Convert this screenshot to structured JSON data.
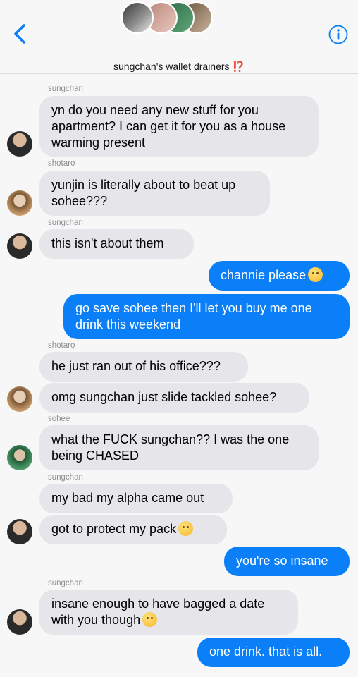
{
  "header": {
    "title": "sungchan's wallet drainers",
    "title_mark": "⁉️",
    "back_icon": "chevron-left-icon",
    "info_icon": "info-icon",
    "accent": "#0b7ff7"
  },
  "messages": [
    {
      "sender": "sungchan",
      "lines": [
        "yn do you need any new stuff for you",
        "apartment? I can get it for you as a house",
        "warming present"
      ]
    },
    {
      "sender": "shotaro",
      "lines": [
        "yunjin is literally about to beat up",
        "sohee???"
      ]
    },
    {
      "sender": "sungchan",
      "lines": [
        "this isn't about them"
      ]
    },
    {
      "sender": "me",
      "lines": [
        "channie please"
      ],
      "emoji": "crying-emoji"
    },
    {
      "sender": "me",
      "lines": [
        "go save sohee then I'll let you buy me one",
        "drink this weekend"
      ]
    },
    {
      "sender": "shotaro",
      "lines": [
        "he just ran out of his office???"
      ]
    },
    {
      "sender": "shotaro",
      "lines": [
        "omg sungchan just slide tackled sohee?"
      ]
    },
    {
      "sender": "sohee",
      "lines": [
        "what the FUCK sungchan?? I was the one",
        "being CHASED"
      ]
    },
    {
      "sender": "sungchan",
      "lines": [
        "my bad my alpha came out"
      ]
    },
    {
      "sender": "sungchan",
      "lines": [
        "got to protect my pack"
      ],
      "emoji": "pensive-emoji"
    },
    {
      "sender": "me",
      "lines": [
        "you're so insane"
      ]
    },
    {
      "sender": "sungchan",
      "lines": [
        "insane enough to have bagged a date",
        "with you though"
      ],
      "emoji": "kissing-emoji"
    },
    {
      "sender": "me",
      "lines": [
        "one drink. that is all."
      ]
    }
  ],
  "sender_labels": {
    "m0": "sungchan",
    "m1": "shotaro",
    "m2": "sungchan",
    "m5": "shotaro",
    "m7": "sohee",
    "m8": "sungchan",
    "m11": "sungchan"
  }
}
